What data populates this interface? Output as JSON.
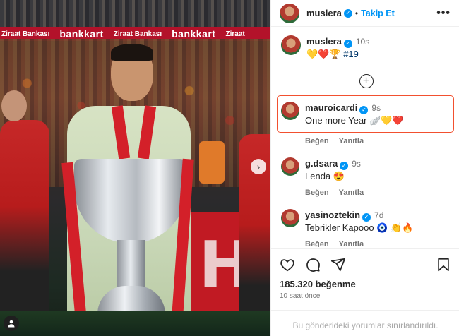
{
  "photo": {
    "banner_items": [
      "Ziraat Bankası",
      "bankkart",
      "Ziraat Bankası",
      "bankkart",
      "Ziraat"
    ],
    "board_text": "H",
    "tag_icon": "user-tag-icon",
    "next_icon": "chevron-right-icon"
  },
  "header": {
    "username": "muslera",
    "verified": "verified-badge",
    "separator": "•",
    "follow_label": "Takip Et",
    "more_label": "•••"
  },
  "caption": {
    "username": "muslera",
    "time": "10s",
    "text": "💛❤️🏆",
    "hashtag": "#19"
  },
  "load_more_icon": "plus-circle-icon",
  "comments": [
    {
      "username": "mauroicardi",
      "time": "9s",
      "text": "One more Year 🪽💛❤️",
      "like_label": "Beğen",
      "reply_label": "Yanıtla",
      "highlighted": true
    },
    {
      "username": "g.dsara",
      "time": "9s",
      "text": "Lenda 😍",
      "like_label": "Beğen",
      "reply_label": "Yanıtla",
      "highlighted": false
    },
    {
      "username": "yasinoztekin",
      "time": "7d",
      "text": "Tebrikler Kapooo 🧿 👏🔥",
      "like_label": "Beğen",
      "reply_label": "Yanıtla",
      "highlighted": false
    }
  ],
  "actions": {
    "like_icon": "heart-icon",
    "comment_icon": "comment-icon",
    "share_icon": "share-icon",
    "save_icon": "bookmark-icon",
    "likes": "185.320 beğenme",
    "time_ago": "10 saat önce",
    "comments_limited": "Bu gönderideki yorumlar sınırlandırıldı."
  },
  "colors": {
    "accent": "#0095f6",
    "highlight_border": "#f2502f",
    "muted": "#737373"
  }
}
